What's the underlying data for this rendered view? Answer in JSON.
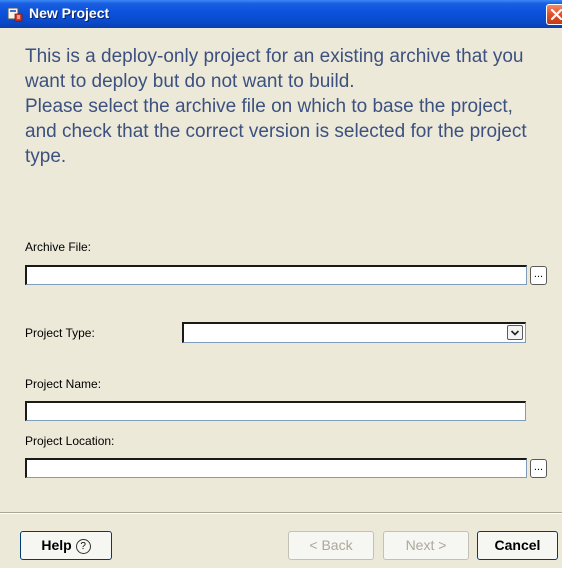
{
  "window": {
    "title": "New Project",
    "icons": {
      "app": "project-wizard-icon",
      "close": "close-icon"
    }
  },
  "intro": {
    "line1": "This is a deploy-only project for an existing archive that you want to deploy but do not want to build.",
    "line2": "Please select the archive file on which to base the project, and check that the correct version is selected for the project type."
  },
  "form": {
    "archive_file": {
      "label": "Archive File:",
      "value": "",
      "browse_label": "..."
    },
    "project_type": {
      "label": "Project Type:",
      "selected": ""
    },
    "project_name": {
      "label": "Project Name:",
      "value": ""
    },
    "project_location": {
      "label": "Project Location:",
      "value": "",
      "browse_label": "..."
    }
  },
  "buttons": {
    "help": "Help",
    "help_icon": "?",
    "back": "< Back",
    "next": "Next >",
    "cancel": "Cancel"
  },
  "colors": {
    "title_bar": "#0a52dd",
    "intro_text": "#3c5180",
    "dialog_bg": "#ece9d8",
    "close_button": "#e0502a"
  }
}
